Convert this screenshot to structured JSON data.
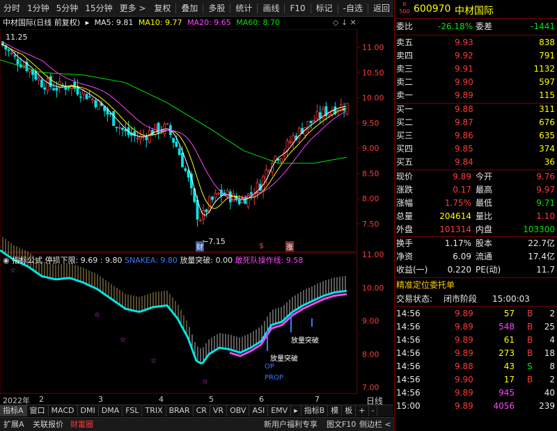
{
  "toolbar": {
    "items": [
      "分时",
      "1分钟",
      "5分钟",
      "15分钟",
      "更多 >"
    ],
    "right_items": [
      "复权",
      "叠加",
      "多股",
      "统计",
      "画线",
      "F10",
      "标记",
      "-自选",
      "返回"
    ]
  },
  "chart": {
    "title": "中材国际(日线 前复权)",
    "ma5": "MA5: 9.81",
    "ma10": "MA10: 9.77",
    "ma20": "MA20: 9.65",
    "ma60": "MA60: 8.70",
    "high_label": "11.25",
    "low_label": "7.15",
    "price_axis": [
      "11.00",
      "10.50",
      "10.00",
      "9.50",
      "9.00",
      "8.50",
      "8.00",
      "7.50"
    ],
    "markers": [
      "财",
      "$",
      "涨"
    ]
  },
  "indicator": {
    "title": "指标公式",
    "stop_loss": "停损下限: 9.69 : 9.80",
    "snake": "SNAKEA: 9.80",
    "volume_break": "放量突破: 0.00",
    "dare_die": "敢死队操作线: 9.58",
    "axis": [
      "11.00",
      "10.00",
      "9.00",
      "8.00",
      "7.00"
    ],
    "annotations": [
      "放量突破",
      "放量突破",
      "OP",
      "PROP"
    ]
  },
  "x_axis": {
    "labels": [
      "2022年",
      "2",
      "3",
      "4",
      "5",
      "6",
      "7"
    ],
    "period": "日线"
  },
  "tabs": {
    "items": [
      "指标A",
      "窗口",
      "MACD",
      "DMI",
      "DMA",
      "FSL",
      "TRIX",
      "BRAR",
      "CR",
      "VR",
      "OBV",
      "ASI",
      "EMV"
    ],
    "right": [
      "指标B",
      "模",
      "板"
    ]
  },
  "bottombar": {
    "left": [
      "扩展A",
      "关联报价",
      "财富圈"
    ],
    "middle": [
      "新用户福利专享",
      "图文F10",
      "侧边栏 <"
    ],
    "right": [
      "笔",
      "价",
      "细",
      "势",
      "联",
      "值",
      "主",
      "筹"
    ]
  },
  "quote": {
    "code": "600970",
    "name": "中材国际",
    "badge_top": "R",
    "badge_bottom": "500",
    "weibi_label": "委比",
    "weibi": "-26.18%",
    "weicha_label": "委差",
    "weicha": "-1441",
    "sell": [
      {
        "label": "卖五",
        "price": "9.93",
        "vol": "838"
      },
      {
        "label": "卖四",
        "price": "9.92",
        "vol": "791"
      },
      {
        "label": "卖三",
        "price": "9.91",
        "vol": "1132"
      },
      {
        "label": "卖二",
        "price": "9.90",
        "vol": "597"
      },
      {
        "label": "卖一",
        "price": "9.89",
        "vol": "115"
      }
    ],
    "buy": [
      {
        "label": "买一",
        "price": "9.88",
        "vol": "311"
      },
      {
        "label": "买二",
        "price": "9.87",
        "vol": "676"
      },
      {
        "label": "买三",
        "price": "9.86",
        "vol": "635"
      },
      {
        "label": "买四",
        "price": "9.85",
        "vol": "374"
      },
      {
        "label": "买五",
        "price": "9.84",
        "vol": "36"
      }
    ],
    "stats": [
      {
        "l1": "现价",
        "v1": "9.89",
        "l2": "今开",
        "v2": "9.76"
      },
      {
        "l1": "涨跌",
        "v1": "0.17",
        "l2": "最高",
        "v2": "9.97"
      },
      {
        "l1": "涨幅",
        "v1": "1.75%",
        "l2": "最低",
        "v2": "9.71"
      },
      {
        "l1": "总量",
        "v1": "204614",
        "l2": "量比",
        "v2": "1.10"
      },
      {
        "l1": "外盘",
        "v1": "101314",
        "l2": "内盘",
        "v2": "103300"
      }
    ],
    "stats2": [
      {
        "l1": "换手",
        "v1": "1.17%",
        "l2": "股本",
        "v2": "22.7亿"
      },
      {
        "l1": "净资",
        "v1": "6.09",
        "l2": "流通",
        "v2": "17.4亿"
      },
      {
        "l1": "收益(一)",
        "v1": "0.220",
        "l2": "PE(动)",
        "v2": "11.7"
      }
    ],
    "precise_label": "精准定位委托单",
    "trade_status_label": "交易状态:",
    "trade_status": "闭市阶段",
    "trade_time": "15:00:03",
    "ticks": [
      {
        "t": "14:56",
        "p": "9.89",
        "v": "57",
        "bs": "B",
        "n": "2"
      },
      {
        "t": "14:56",
        "p": "9.89",
        "v": "548",
        "bs": "B",
        "n": "25"
      },
      {
        "t": "14:56",
        "p": "9.89",
        "v": "61",
        "bs": "B",
        "n": "4"
      },
      {
        "t": "14:56",
        "p": "9.89",
        "v": "273",
        "bs": "B",
        "n": "18"
      },
      {
        "t": "14:56",
        "p": "9.88",
        "v": "43",
        "bs": "S",
        "n": "8"
      },
      {
        "t": "14:56",
        "p": "9.90",
        "v": "17",
        "bs": "B",
        "n": "2"
      },
      {
        "t": "14:56",
        "p": "9.89",
        "v": "945",
        "bs": "",
        "n": "40"
      },
      {
        "t": "15:00",
        "p": "9.89",
        "v": "4056",
        "bs": "",
        "n": "239"
      }
    ]
  },
  "colors": {
    "up": "#ff3b3b",
    "down": "#00e6e6",
    "ma5": "#ffffff",
    "ma10": "#ffff00",
    "ma20": "#ff44ff",
    "ma60": "#00e600"
  }
}
